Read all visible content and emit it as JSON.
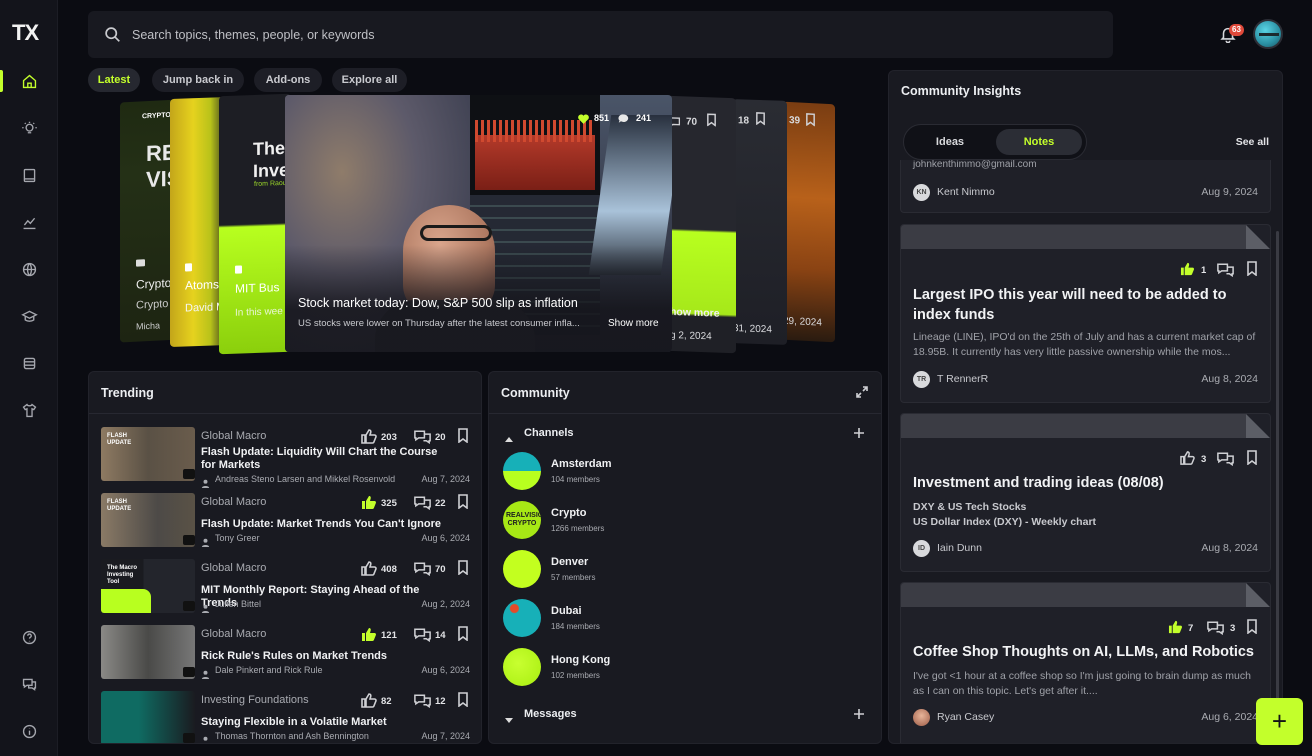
{
  "brand": {
    "logo": "TX"
  },
  "search": {
    "placeholder": "Search topics, themes, people, or keywords"
  },
  "notifications": {
    "count": "63"
  },
  "filters": [
    {
      "label": "Latest",
      "active": true
    },
    {
      "label": "Jump back in"
    },
    {
      "label": "Add-ons"
    },
    {
      "label": "Explore all"
    }
  ],
  "carousel": {
    "featured": {
      "title": "Stock market today: Dow, S&P 500 slip as inflation",
      "subtitle": "US stocks were lower on Thursday after the latest consumer infla...",
      "show_more": "Show more",
      "likes": "851",
      "comments": "241"
    },
    "left_cards": [
      {
        "brand": "CRYPTO",
        "headline": "REA VIS",
        "line1": "Crypto",
        "line2": "Crypto",
        "line3": "Micha"
      },
      {
        "line1": "Atoms",
        "line2": "David M"
      },
      {
        "headline": "The Inve",
        "tag": "from Raou",
        "line1": "MIT Bus",
        "line2": "In this wee"
      }
    ],
    "right_cards": [
      {
        "comments": "70",
        "show_more": "how more",
        "date": "g 2, 2024"
      },
      {
        "count": "18",
        "date": "31, 2024"
      },
      {
        "count": "39",
        "date": "29, 2024"
      }
    ]
  },
  "trending": {
    "title": "Trending",
    "items": [
      {
        "category": "Global Macro",
        "title": "Flash Update: Liquidity Will Chart the Course for Markets",
        "author": "Andreas Steno Larsen and Mikkel Rosenvold",
        "date": "Aug 7, 2024",
        "likes": "203",
        "comments": "20",
        "liked": false,
        "thumb_label": "FLASH UPDATE"
      },
      {
        "category": "Global Macro",
        "title": "Flash Update: Market Trends You Can't Ignore",
        "author": "Tony Greer",
        "date": "Aug 6, 2024",
        "likes": "325",
        "comments": "22",
        "liked": true,
        "thumb_label": "FLASH UPDATE"
      },
      {
        "category": "Global Macro",
        "title": "MIT Monthly Report: Staying Ahead of the Trends",
        "author": "Julien Bittel",
        "date": "Aug 2, 2024",
        "likes": "408",
        "comments": "70",
        "liked": false,
        "thumb_label": "The Macro Investing Tool"
      },
      {
        "category": "Global Macro",
        "title": "Rick Rule's Rules on Market Trends",
        "author": "Dale Pinkert and Rick Rule",
        "date": "Aug 6, 2024",
        "likes": "121",
        "comments": "14",
        "liked": true,
        "thumb_label": ""
      },
      {
        "category": "Investing Foundations",
        "title": "Staying Flexible in a Volatile Market",
        "author": "Thomas Thornton and Ash Bennington",
        "date": "Aug 7, 2024",
        "likes": "82",
        "comments": "12",
        "liked": false,
        "thumb_label": ""
      }
    ]
  },
  "community": {
    "title": "Community",
    "channels_label": "Channels",
    "messages_label": "Messages",
    "channels": [
      {
        "name": "Amsterdam",
        "members": "104 members"
      },
      {
        "name": "Crypto",
        "members": "1266 members",
        "logo_text": "REALVISION CRYPTO"
      },
      {
        "name": "Denver",
        "members": "57 members"
      },
      {
        "name": "Dubai",
        "members": "184 members"
      },
      {
        "name": "Hong Kong",
        "members": "102 members"
      }
    ]
  },
  "insights": {
    "title": "Community Insights",
    "tabs": [
      {
        "label": "Ideas"
      },
      {
        "label": "Notes",
        "active": true
      }
    ],
    "see_all": "See all",
    "partial": {
      "text": "johnkenthimmo@gmail.com",
      "author": "Kent Nimmo",
      "initials": "KN",
      "date": "Aug 9, 2024"
    },
    "cards": [
      {
        "title": "Largest IPO this year will need to be added to index funds",
        "desc": "Lineage (LINE), IPO'd on the 25th of July and has a current market cap of 18.95B. It currently has very little passive ownership while the mos...",
        "author": "T RennerR",
        "initials": "TR",
        "date": "Aug 8, 2024",
        "likes": "1",
        "liked": true
      },
      {
        "title": "Investment and trading ideas (08/08)",
        "line1": "DXY & US Tech Stocks",
        "line2": "US Dollar Index (DXY) - Weekly chart",
        "author": "Iain Dunn",
        "initials": "ID",
        "date": "Aug 8, 2024",
        "likes": "3",
        "liked": false
      },
      {
        "title": "Coffee Shop Thoughts on AI, LLMs, and Robotics",
        "desc": "I've got <1 hour at a coffee shop so I'm just going to brain dump as much as I can on this topic. Let's get after it....",
        "author": "Ryan Casey",
        "initials": "RC",
        "date": "Aug 6, 2024",
        "likes": "7",
        "comments": "3",
        "liked": true
      }
    ]
  },
  "fab": {
    "label": "+"
  },
  "colors": {
    "accent": "#c3ff2b",
    "background": "#0b0c12",
    "panel": "#191a21"
  }
}
